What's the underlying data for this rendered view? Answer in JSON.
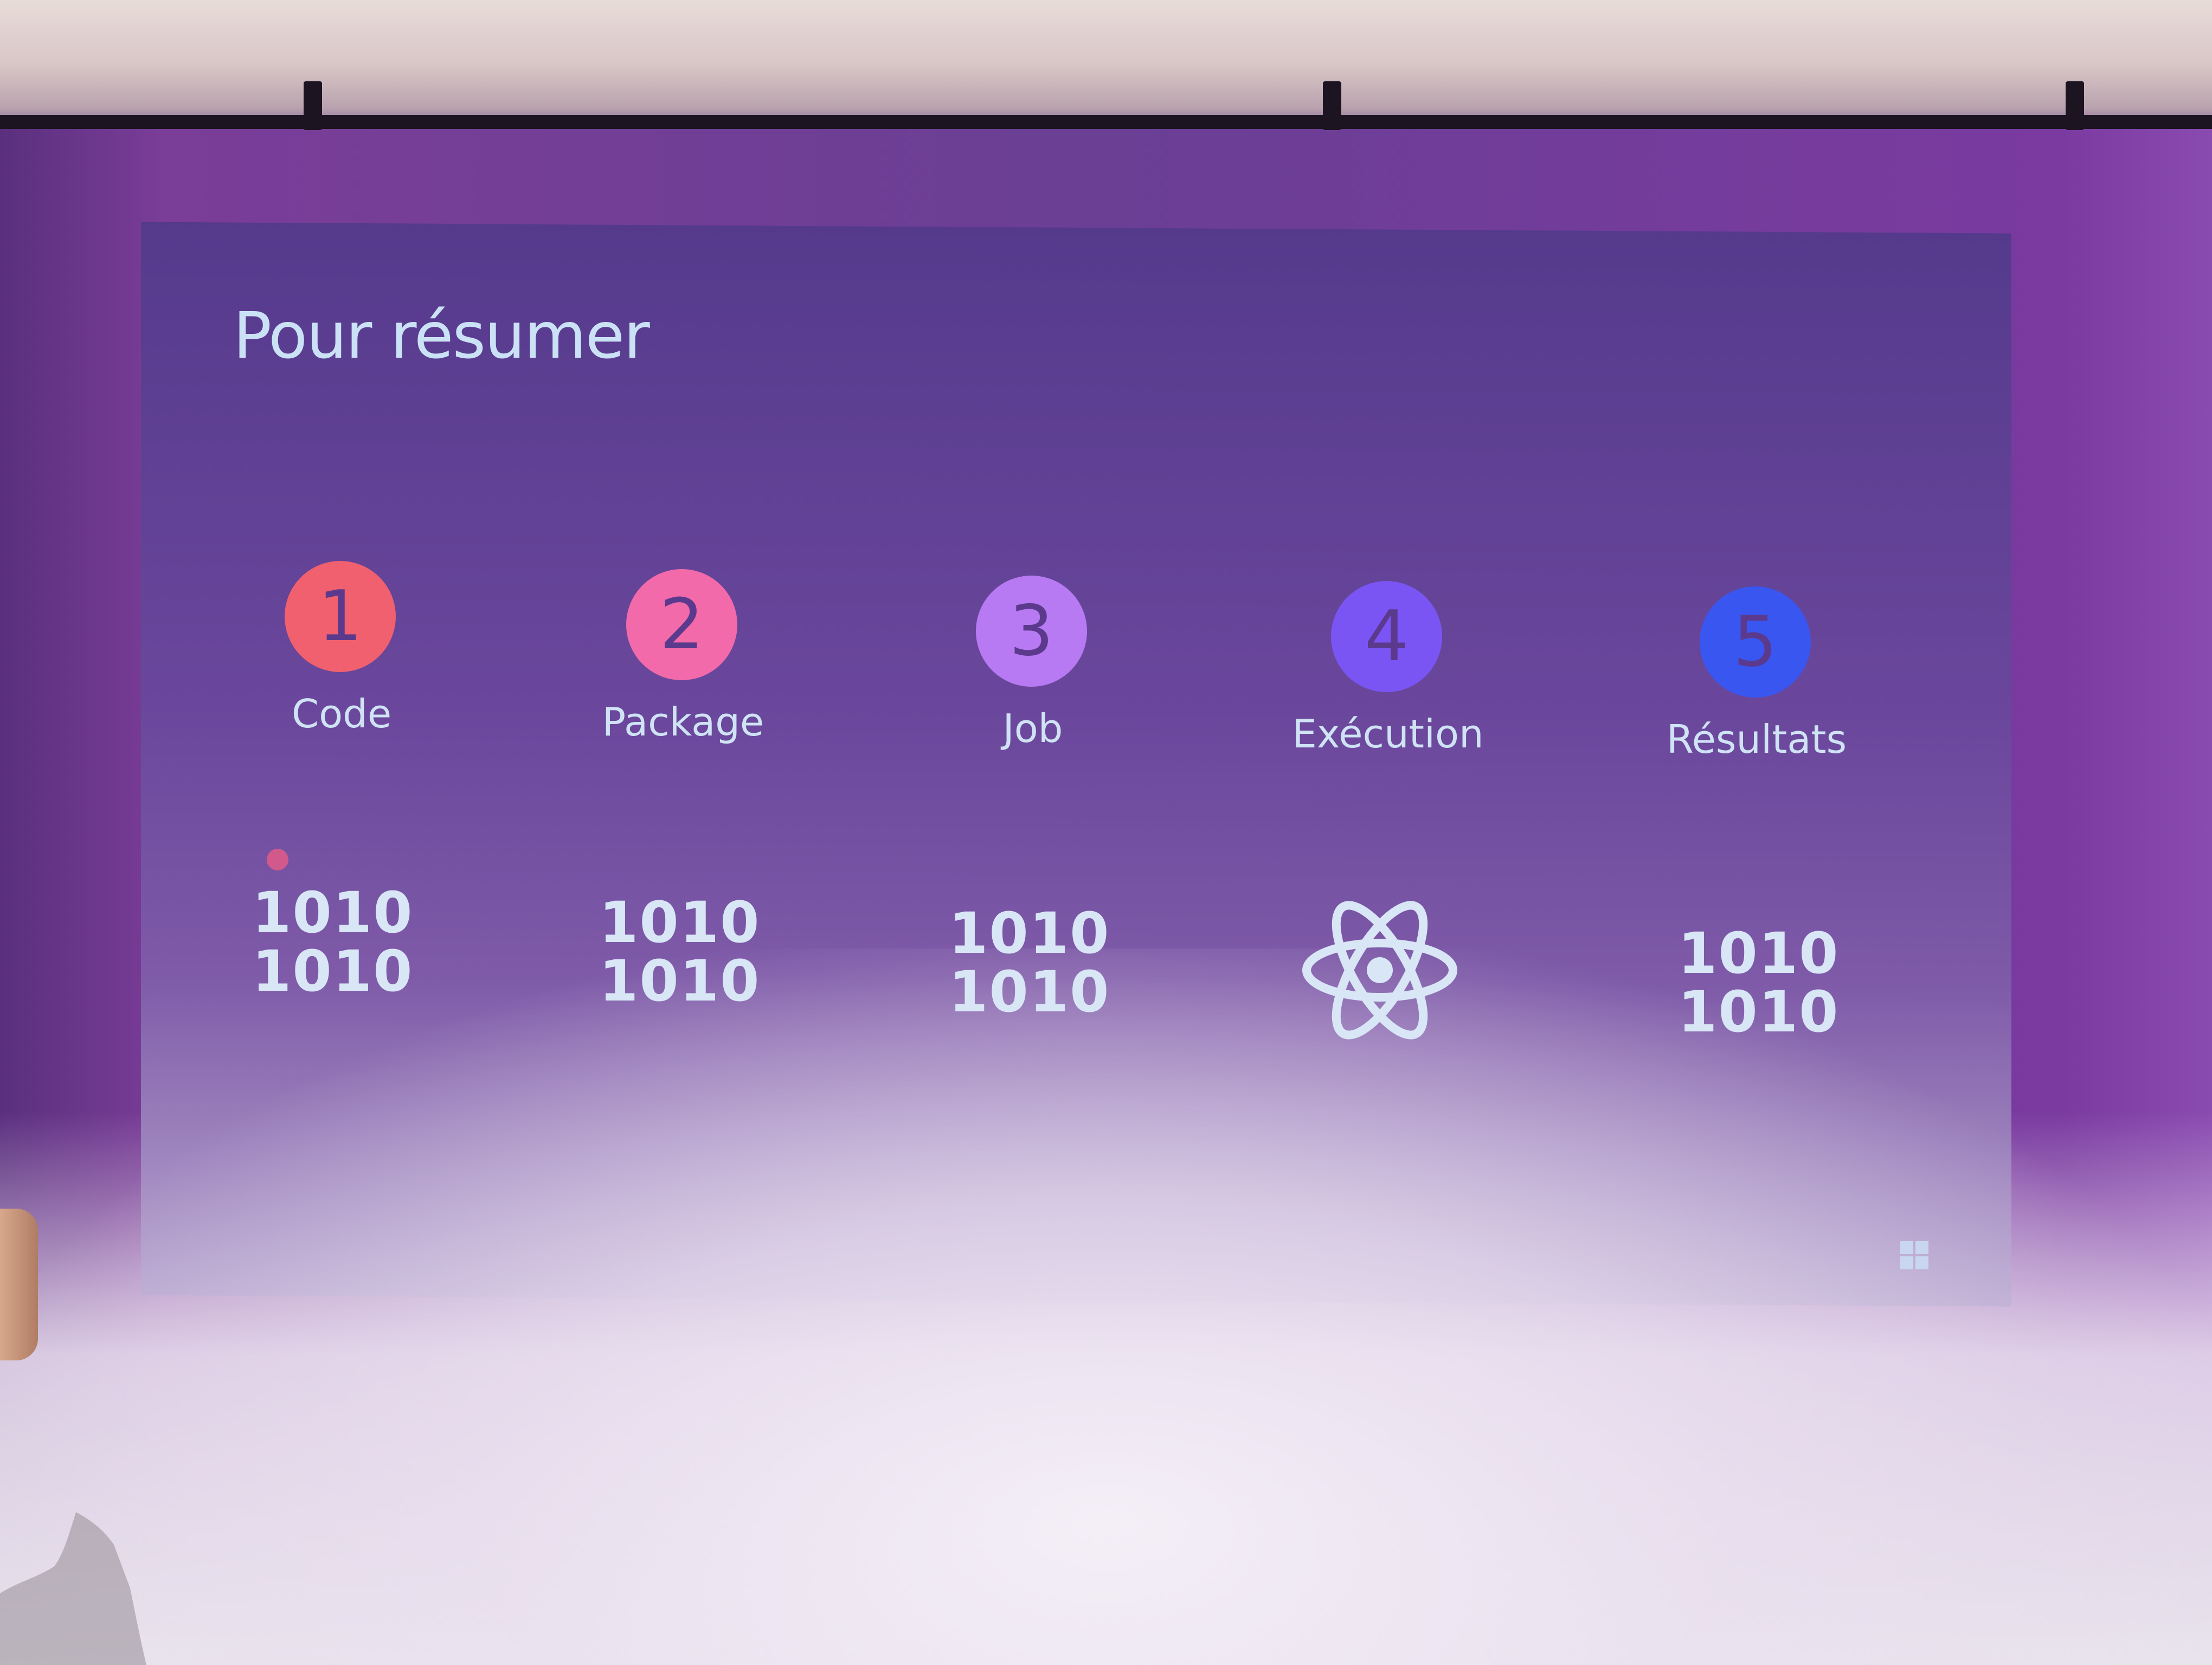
{
  "slide": {
    "title": "Pour résumer",
    "steps": [
      {
        "number": "1",
        "label": "Code",
        "color": "#f0606e",
        "icon": "binary"
      },
      {
        "number": "2",
        "label": "Package",
        "color": "#f26aaa",
        "icon": "binary"
      },
      {
        "number": "3",
        "label": "Job",
        "color": "#b77af2",
        "icon": "binary"
      },
      {
        "number": "4",
        "label": "Exécution",
        "color": "#7b55f3",
        "icon": "atom"
      },
      {
        "number": "5",
        "label": "Résultats",
        "color": "#3956f0",
        "icon": "binary"
      }
    ],
    "binary_text": {
      "line1": "1010",
      "line2": "1010"
    }
  }
}
